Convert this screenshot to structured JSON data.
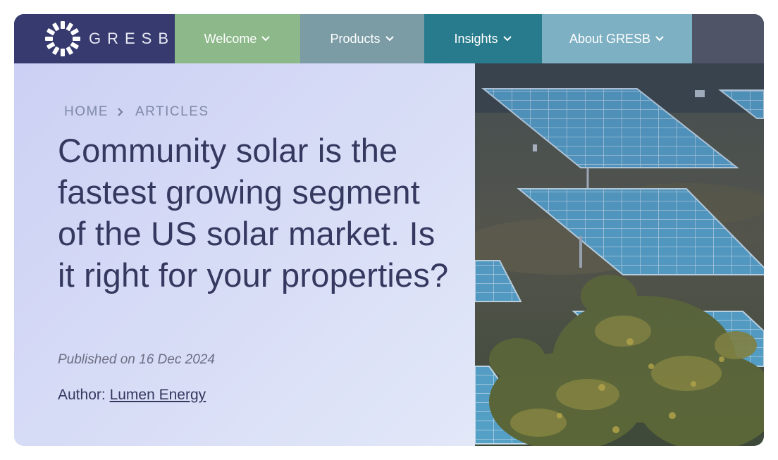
{
  "brand": {
    "name": "GRESB",
    "logo_icon": "gresb-sunburst-icon"
  },
  "nav": {
    "items": [
      {
        "label": "Welcome",
        "color": "#8cb88a"
      },
      {
        "label": "Products",
        "color": "#7b9ca5"
      },
      {
        "label": "Insights",
        "color": "#277b8c"
      },
      {
        "label": "About GRESB",
        "color": "#7eb0c3"
      }
    ],
    "dropdown_icon": "chevron-down-icon"
  },
  "breadcrumb": {
    "items": [
      "HOME",
      "ARTICLES"
    ],
    "separator_icon": "chevron-right-icon"
  },
  "article": {
    "title": "Community solar is the fastest growing segment of the US solar market. Is it right for your properties?",
    "published": "Published on 16 Dec 2024",
    "author_prefix": "Author:",
    "author_name": "Lumen Energy"
  },
  "hero_image": {
    "subject": "solar-panels-field-image"
  },
  "colors": {
    "brand_navy": "#363a6e",
    "title_text": "#35385f",
    "panel_bg": "#d6dbf6"
  }
}
